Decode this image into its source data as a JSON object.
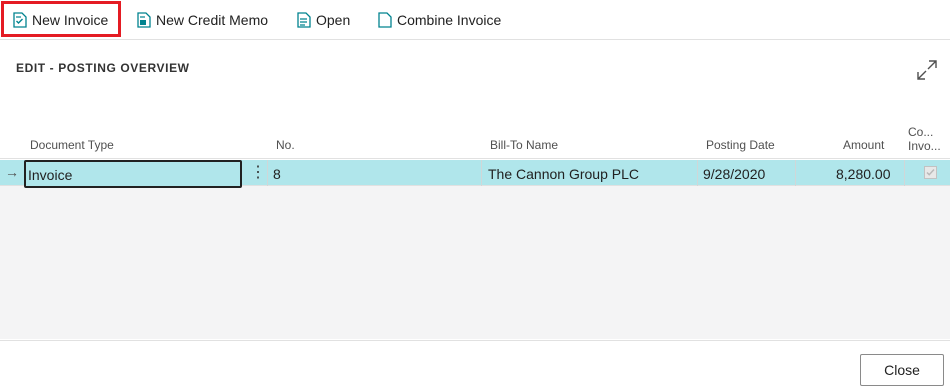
{
  "toolbar": {
    "new_invoice": "New Invoice",
    "new_credit_memo": "New Credit Memo",
    "open": "Open",
    "combine_invoice": "Combine Invoice"
  },
  "page": {
    "title": "EDIT - POSTING OVERVIEW"
  },
  "columns": {
    "document_type": "Document Type",
    "no": "No.",
    "bill_to_name": "Bill-To Name",
    "posting_date": "Posting Date",
    "amount": "Amount",
    "combine_invoice_line1": "Co...",
    "combine_invoice_line2": "Invo..."
  },
  "rows": [
    {
      "document_type": "Invoice",
      "no": "8",
      "bill_to_name": "The Cannon Group PLC",
      "posting_date": "9/28/2020",
      "amount": "8,280.00",
      "combine_invoice": true
    }
  ],
  "footer": {
    "close": "Close"
  },
  "colors": {
    "accent_teal": "#00838f",
    "selected_row": "#b0e6eb",
    "highlight": "#e41b23"
  },
  "icons": [
    "new-document-icon",
    "credit-memo-icon",
    "open-document-icon",
    "blank-document-icon",
    "expand-icon",
    "row-arrow-icon",
    "more-options-icon",
    "checkmark-icon"
  ]
}
